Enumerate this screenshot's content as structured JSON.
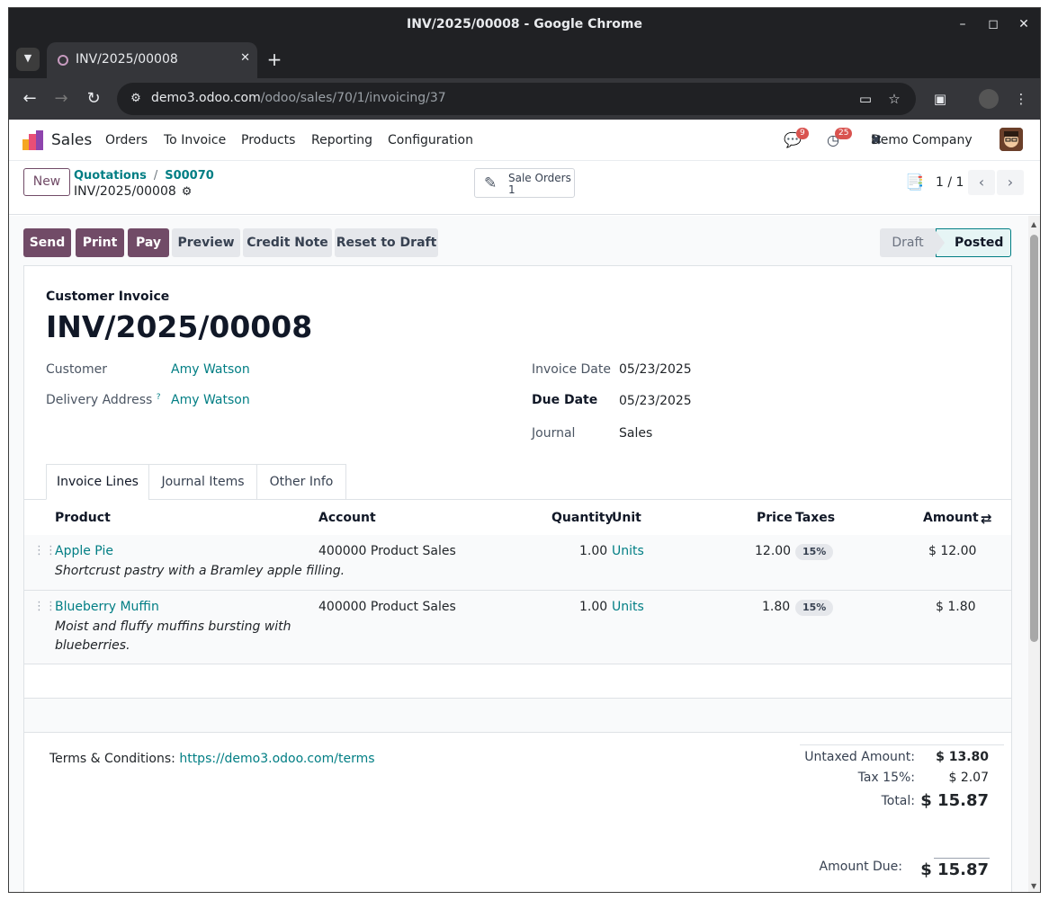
{
  "window": {
    "title": "INV/2025/00008 - Google Chrome",
    "tab_title": "INV/2025/00008",
    "url_host": "demo3.odoo.com",
    "url_path": "/odoo/sales/70/1/invoicing/37"
  },
  "navbar": {
    "app_name": "Sales",
    "menu": [
      "Orders",
      "To Invoice",
      "Products",
      "Reporting",
      "Configuration"
    ],
    "messages_count": "9",
    "activities_count": "25",
    "company": "Demo Company"
  },
  "control_panel": {
    "new_label": "New",
    "breadcrumb": [
      "Quotations",
      "S00070"
    ],
    "record_name": "INV/2025/00008",
    "smart_button_label": "Sale Orders",
    "smart_button_value": "1",
    "pager": "1 / 1"
  },
  "actions": {
    "send": "Send",
    "print": "Print",
    "pay": "Pay",
    "preview": "Preview",
    "credit_note": "Credit Note",
    "reset_to_draft": "Reset to Draft"
  },
  "status": {
    "draft": "Draft",
    "posted": "Posted",
    "current": "Posted"
  },
  "invoice": {
    "type": "Customer Invoice",
    "name": "INV/2025/00008",
    "customer_label": "Customer",
    "customer": "Amy Watson",
    "delivery_label": "Delivery Address",
    "delivery_help": "?",
    "delivery": "Amy Watson",
    "invoice_date_label": "Invoice Date",
    "invoice_date": "05/23/2025",
    "due_date_label": "Due Date",
    "due_date": "05/23/2025",
    "journal_label": "Journal",
    "journal": "Sales"
  },
  "tabs": [
    "Invoice Lines",
    "Journal Items",
    "Other Info"
  ],
  "lines": {
    "headers": {
      "product": "Product",
      "account": "Account",
      "quantity": "Quantity",
      "unit": "Unit",
      "price": "Price",
      "taxes": "Taxes",
      "amount": "Amount"
    },
    "rows": [
      {
        "product": "Apple Pie",
        "description": "Shortcrust pastry with a Bramley apple filling.",
        "account": "400000 Product Sales",
        "quantity": "1.00",
        "unit": "Units",
        "price": "12.00",
        "tax": "15%",
        "amount": "$ 12.00"
      },
      {
        "product": "Blueberry Muffin",
        "description_line1": "Moist and fluffy muffins bursting with",
        "description_line2": "blueberries.",
        "account": "400000 Product Sales",
        "quantity": "1.00",
        "unit": "Units",
        "price": "1.80",
        "tax": "15%",
        "amount": "$ 1.80"
      }
    ]
  },
  "footer": {
    "terms_label": "Terms & Conditions:",
    "terms_link": "https://demo3.odoo.com/terms",
    "untaxed_label": "Untaxed Amount:",
    "untaxed": "$ 13.80",
    "tax_label": "Tax 15%:",
    "tax": "$ 2.07",
    "total_label": "Total:",
    "total": "$ 15.87",
    "due_label": "Amount Due:",
    "due": "$ 15.87"
  },
  "colors": {
    "brand": "#714b67",
    "link": "#017e84",
    "badge": "#d9534f"
  }
}
